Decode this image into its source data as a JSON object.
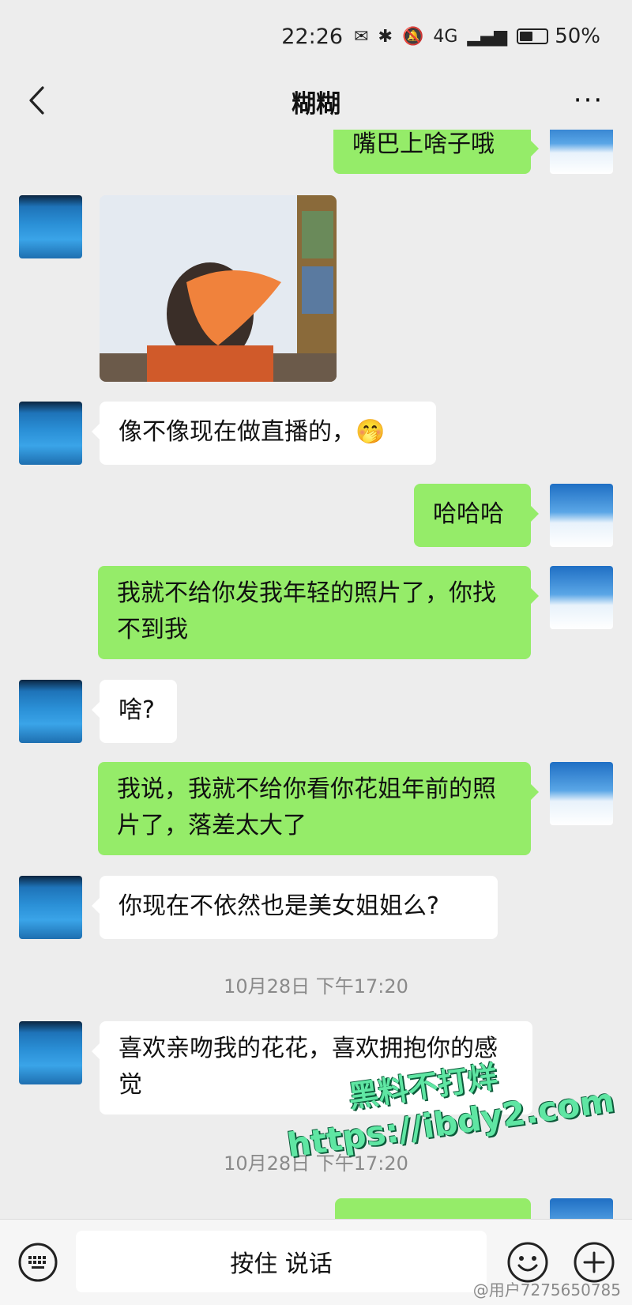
{
  "status_bar": {
    "time": "22:26",
    "network": "4G",
    "battery_percent": "50%",
    "battery_level": 0.5
  },
  "header": {
    "title": "糊糊",
    "more_label": "···"
  },
  "messages": [
    {
      "side": "right",
      "text": "嘴巴上啥子哦"
    },
    {
      "side": "left",
      "type": "image"
    },
    {
      "side": "left",
      "text": "像不像现在做直播的，🤭"
    },
    {
      "side": "right",
      "text": "哈哈哈"
    },
    {
      "side": "right",
      "text": "我就不给你发我年轻的照片了，你找不到我"
    },
    {
      "side": "left",
      "text": "啥?"
    },
    {
      "side": "right",
      "text": "我说，我就不给你看你花姐年前的照片了，落差太大了"
    },
    {
      "side": "left",
      "text": "你现在不依然也是美女姐姐么?"
    },
    {
      "type": "timestamp",
      "text": "10月28日 下午17:20"
    },
    {
      "side": "left",
      "text": "喜欢亲吻我的花花，喜欢拥抱你的感觉"
    },
    {
      "type": "timestamp",
      "text": "10月28日 下午17:20"
    }
  ],
  "watermark": {
    "line1": "黑料不打烊",
    "line2": "https://ibdy2.com"
  },
  "input_bar": {
    "voice_label": "按住 说话"
  },
  "weibo_credit": "@用户7275650785",
  "colors": {
    "background": "#ededed",
    "my_bubble": "#95ec69",
    "their_bubble": "#ffffff"
  }
}
